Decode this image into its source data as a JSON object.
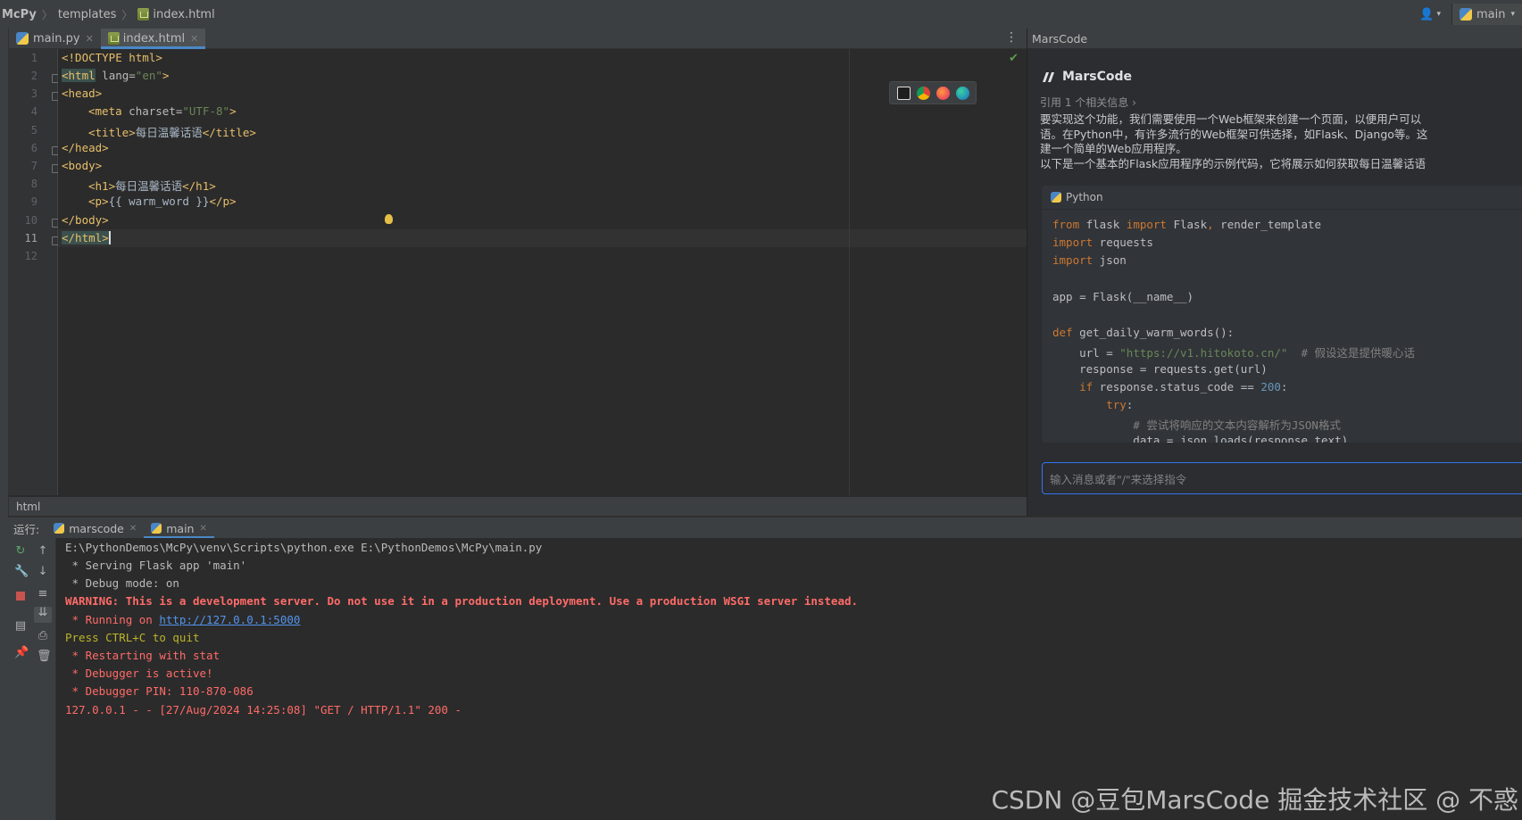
{
  "navbar": {
    "project": "McPy",
    "folder": "templates",
    "file": "index.html",
    "branch": "main"
  },
  "tabs": [
    {
      "label": "main.py"
    },
    {
      "label": "index.html"
    }
  ],
  "editor": {
    "line_numbers": [
      "1",
      "2",
      "3",
      "4",
      "5",
      "6",
      "7",
      "8",
      "9",
      "10",
      "11",
      "12"
    ],
    "lines": {
      "l1": "<!DOCTYPE html>",
      "l2_tag": "<html",
      "l2_attr": " lang=",
      "l2_val": "\"en\"",
      "l2_end": ">",
      "l3": "<head>",
      "l4_tag": "<meta",
      "l4_attr": " charset=",
      "l4_val": "\"UTF-8\"",
      "l4_end": ">",
      "l5_open": "<title>",
      "l5_text": "每日温馨话语",
      "l5_close": "</title>",
      "l6": "</head>",
      "l7": "<body>",
      "l8_open": "<h1>",
      "l8_text": "每日温馨话语",
      "l8_close": "</h1>",
      "l9_open": "<p>",
      "l9_text": "{{ warm_word }}",
      "l9_close": "</p>",
      "l10": "</body>",
      "l11": "</html>"
    },
    "breadcrumb": "html"
  },
  "marscode": {
    "panel_header": "MarsCode",
    "title": "MarsCode",
    "reference": "引用 1 个相关信息 ›",
    "text_lines": [
      "要实现这个功能，我们需要使用一个Web框架来创建一个页面，以便用户可以",
      "语。在Python中，有许多流行的Web框架可供选择，如Flask、Django等。这",
      "建一个简单的Web应用程序。",
      "以下是一个基本的Flask应用程序的示例代码，它将展示如何获取每日温馨话语"
    ],
    "code_language": "Python",
    "code": {
      "c1_kw": "from",
      "c1_a": " flask ",
      "c1_kw2": "import",
      "c1_b": " Flask",
      "c1_comma": ",",
      "c1_c": " render_template",
      "c2_kw": "import",
      "c2_a": " requests",
      "c3_kw": "import",
      "c3_a": " json",
      "c5": "app = Flask(__name__)",
      "c7_kw": "def",
      "c7_a": " get_daily_warm_words():",
      "c8_a": "    url = ",
      "c8_str": "\"https://v1.hitokoto.cn/\"",
      "c8_cm": "  # 假设这是提供暖心话",
      "c9": "    response = requests.get(url)",
      "c10_kw": "    if",
      "c10_a": " response.status_code == ",
      "c10_num": "200",
      "c10_b": ":",
      "c11_kw": "        try",
      "c11_a": ":",
      "c12_cm": "            # 尝试将响应的文本内容解析为JSON格式",
      "c13": "            data = json.loads(response.text)"
    },
    "input_placeholder": "输入消息或者\"/\"来选择指令"
  },
  "run": {
    "label": "运行:",
    "tabs": [
      {
        "label": "marscode"
      },
      {
        "label": "main"
      }
    ],
    "console": {
      "line1": "E:\\PythonDemos\\McPy\\venv\\Scripts\\python.exe E:\\PythonDemos\\McPy\\main.py",
      "line2": " * Serving Flask app 'main'",
      "line3": " * Debug mode: on",
      "line4": "WARNING: This is a development server. Do not use it in a production deployment. Use a production WSGI server instead.",
      "line5_prefix": " * Running on ",
      "line5_link": "http://127.0.0.1:5000",
      "line6": "Press CTRL+C to quit",
      "line7": " * Restarting with stat",
      "line8": " * Debugger is active!",
      "line9": " * Debugger PIN: 110-870-086",
      "line10": "127.0.0.1 - - [27/Aug/2024 14:25:08] \"GET / HTTP/1.1\" 200 -"
    }
  },
  "watermark": "CSDN @豆包MarsCode  掘金技术社区 @ 不惑",
  "colors": {
    "accent": "#4a88c7",
    "warning": "#ff6b68",
    "tag": "#e8bf6a",
    "string": "#6a8759",
    "keyword": "#cc7832"
  }
}
